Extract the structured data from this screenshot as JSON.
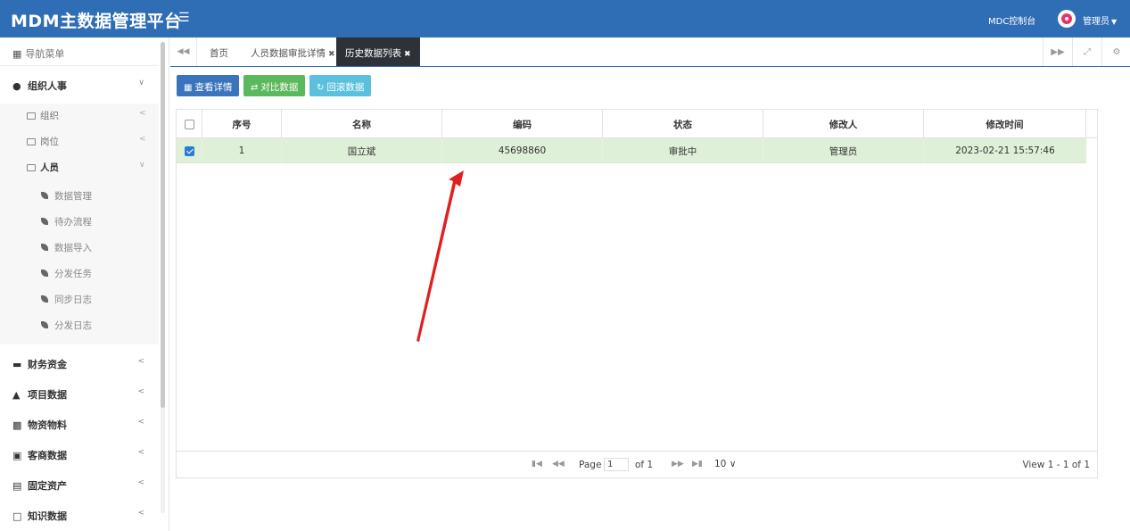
{
  "header": {
    "logo": "MDM主数据管理平台",
    "console": "MDC控制台",
    "user": "管理员"
  },
  "sidebar": {
    "title": "导航菜单",
    "groups": [
      {
        "label": "组织人事",
        "expanded": true
      },
      {
        "label": "财务资金"
      },
      {
        "label": "项目数据"
      },
      {
        "label": "物资物料"
      },
      {
        "label": "客商数据"
      },
      {
        "label": "固定资产"
      },
      {
        "label": "知识数据"
      }
    ],
    "sub": [
      "组织",
      "岗位",
      "人员"
    ],
    "leaves": [
      "数据管理",
      "待办流程",
      "数据导入",
      "分发任务",
      "同步日志",
      "分发日志"
    ]
  },
  "tabs": [
    {
      "label": "首页"
    },
    {
      "label": "人员数据审批详情"
    },
    {
      "label": "历史数据列表",
      "active": true
    }
  ],
  "toolbar": {
    "view": "查看详情",
    "compare": "对比数据",
    "rollback": "回滚数据"
  },
  "grid": {
    "columns": [
      "序号",
      "名称",
      "编码",
      "状态",
      "修改人",
      "修改时间"
    ],
    "rows": [
      {
        "seq": "1",
        "name": "国立斌",
        "code": "45698860",
        "status": "审批中",
        "modifier": "管理员",
        "time": "2023-02-21 15:57:46",
        "selected": true
      }
    ]
  },
  "pager": {
    "page_label": "Page",
    "page_value": "1",
    "of_label": "of 1",
    "page_size": "10",
    "view_text": "View 1 - 1 of 1"
  },
  "colors": {
    "primary": "#2f6db5",
    "selected_row": "#dff0d8",
    "btn_green": "#5cb85c",
    "btn_cyan": "#5bc0de",
    "arrow": "#e02020"
  }
}
